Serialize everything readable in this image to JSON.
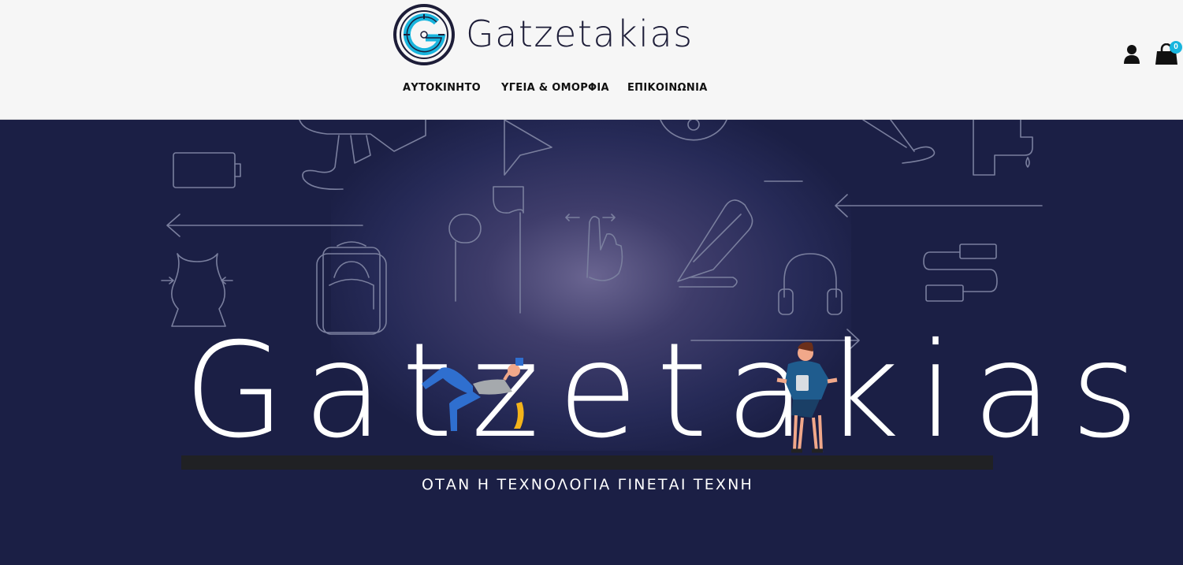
{
  "header": {
    "brand": "Gatzetakias",
    "nav": [
      {
        "label": "ΑΥΤΟΚΙΝΗΤΟ"
      },
      {
        "label": "ΥΓΕΙΑ & ΟΜΟΡΦΙΑ"
      },
      {
        "label": "ΕΠΙΚΟΙΝΩΝΙΑ"
      }
    ],
    "icons": {
      "user": "user-icon",
      "cart": "shopping-bag-icon"
    },
    "cart_count": "0"
  },
  "hero": {
    "wordmark": "Gatzetakias",
    "tagline": "ΟΤΑΝ Η ΤΕΧΝΟΛΟΓΙΑ ΓΙΝΕΤΑΙ ΤΕΧΝΗ",
    "illustrations": [
      "megaphone",
      "play-cursor",
      "disc",
      "tap",
      "battery",
      "left-arrow",
      "earphones",
      "swipe-hand",
      "hair-straightener",
      "cable",
      "body-shape",
      "backpack",
      "headphones",
      "right-arrow"
    ]
  },
  "colors": {
    "header_bg": "#f6f6f6",
    "hero_bg": "#1b1f45",
    "accent": "#18b5de",
    "text_dark": "#111111"
  }
}
